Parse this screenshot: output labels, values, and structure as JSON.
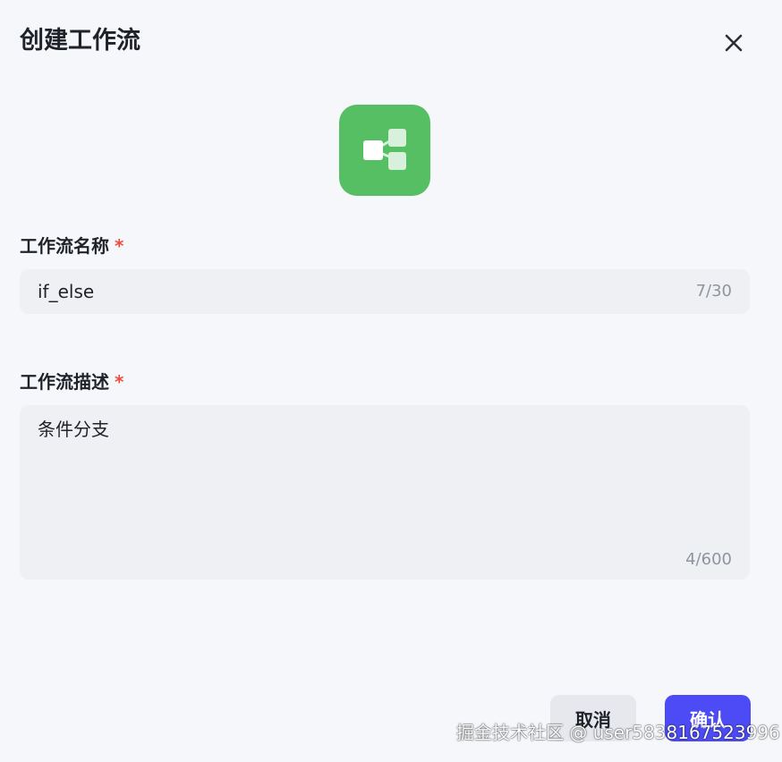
{
  "dialog": {
    "title": "创建工作流",
    "close_icon": "close-icon",
    "app_icon": "workflow-branch-icon",
    "accent_color": "#56bf63"
  },
  "name_field": {
    "label": "工作流名称",
    "required_mark": "*",
    "value": "if_else",
    "counter": "7/30"
  },
  "description_field": {
    "label": "工作流描述",
    "required_mark": "*",
    "value": "条件分支",
    "counter": "4/600"
  },
  "footer": {
    "cancel_label": "取消",
    "confirm_label": "确认",
    "confirm_color": "#4c4bf5"
  },
  "watermark": "掘金技术社区 @ user5838167523996"
}
